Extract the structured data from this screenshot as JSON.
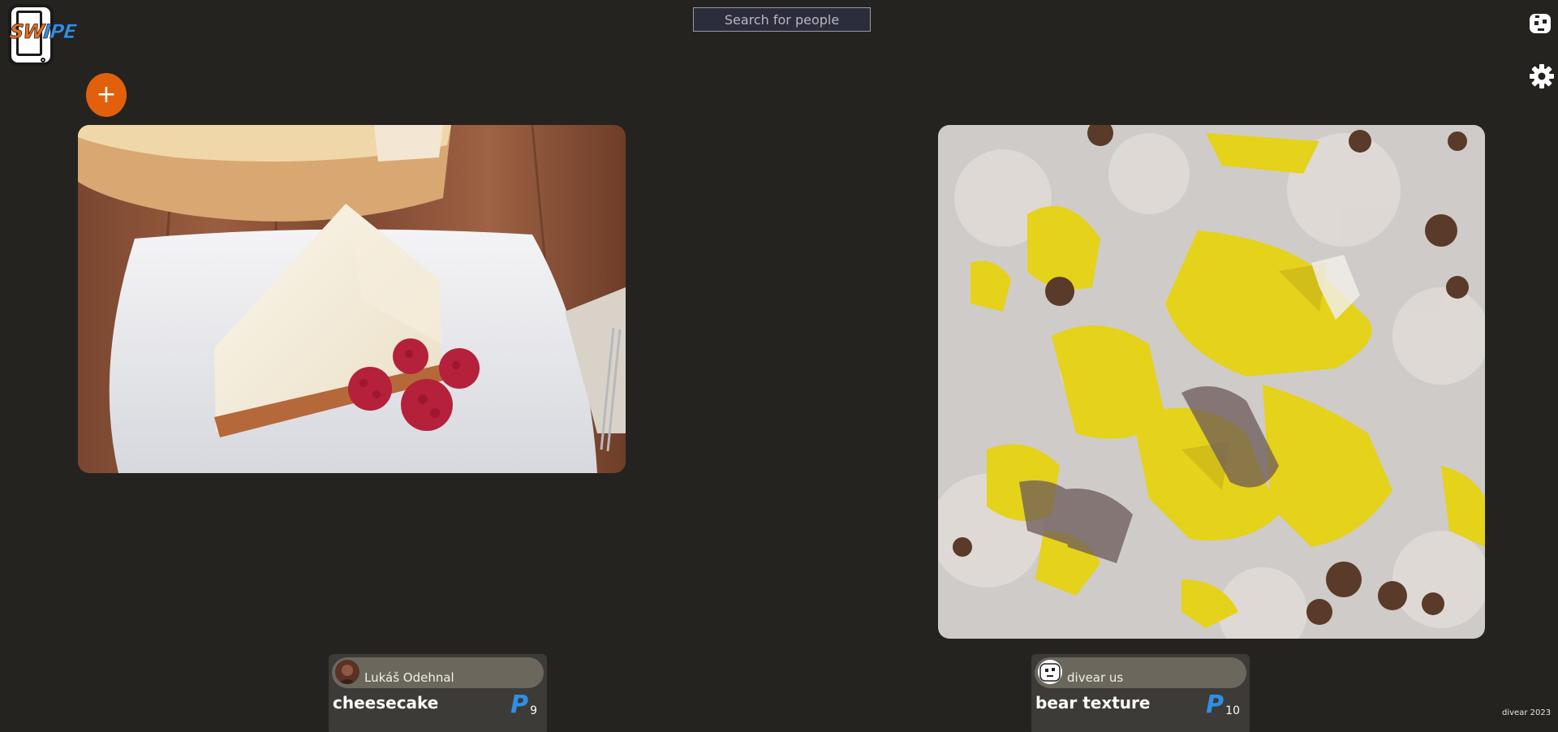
{
  "logo": {
    "text_left": "SW",
    "text_right": "IPE"
  },
  "search": {
    "placeholder": "Search for people"
  },
  "header": {
    "user_icon": "robot-avatar-icon",
    "settings_icon": "gear-icon"
  },
  "actions": {
    "add_label": "+"
  },
  "posts": [
    {
      "author": "Lukáš Odehnal",
      "title": "cheesecake",
      "points": "9",
      "points_symbol": "P",
      "image": "cheesecake-photo"
    },
    {
      "author": "divear us",
      "title": "bear texture",
      "points": "10",
      "points_symbol": "P",
      "image": "bear-texture-image"
    }
  ],
  "footer": {
    "text": "divear 2023"
  },
  "colors": {
    "background": "#252320",
    "accent_orange": "#e2600c",
    "points_blue": "#2f8fe6",
    "card": "#3d3b37",
    "author_bar": "#6b675d"
  }
}
